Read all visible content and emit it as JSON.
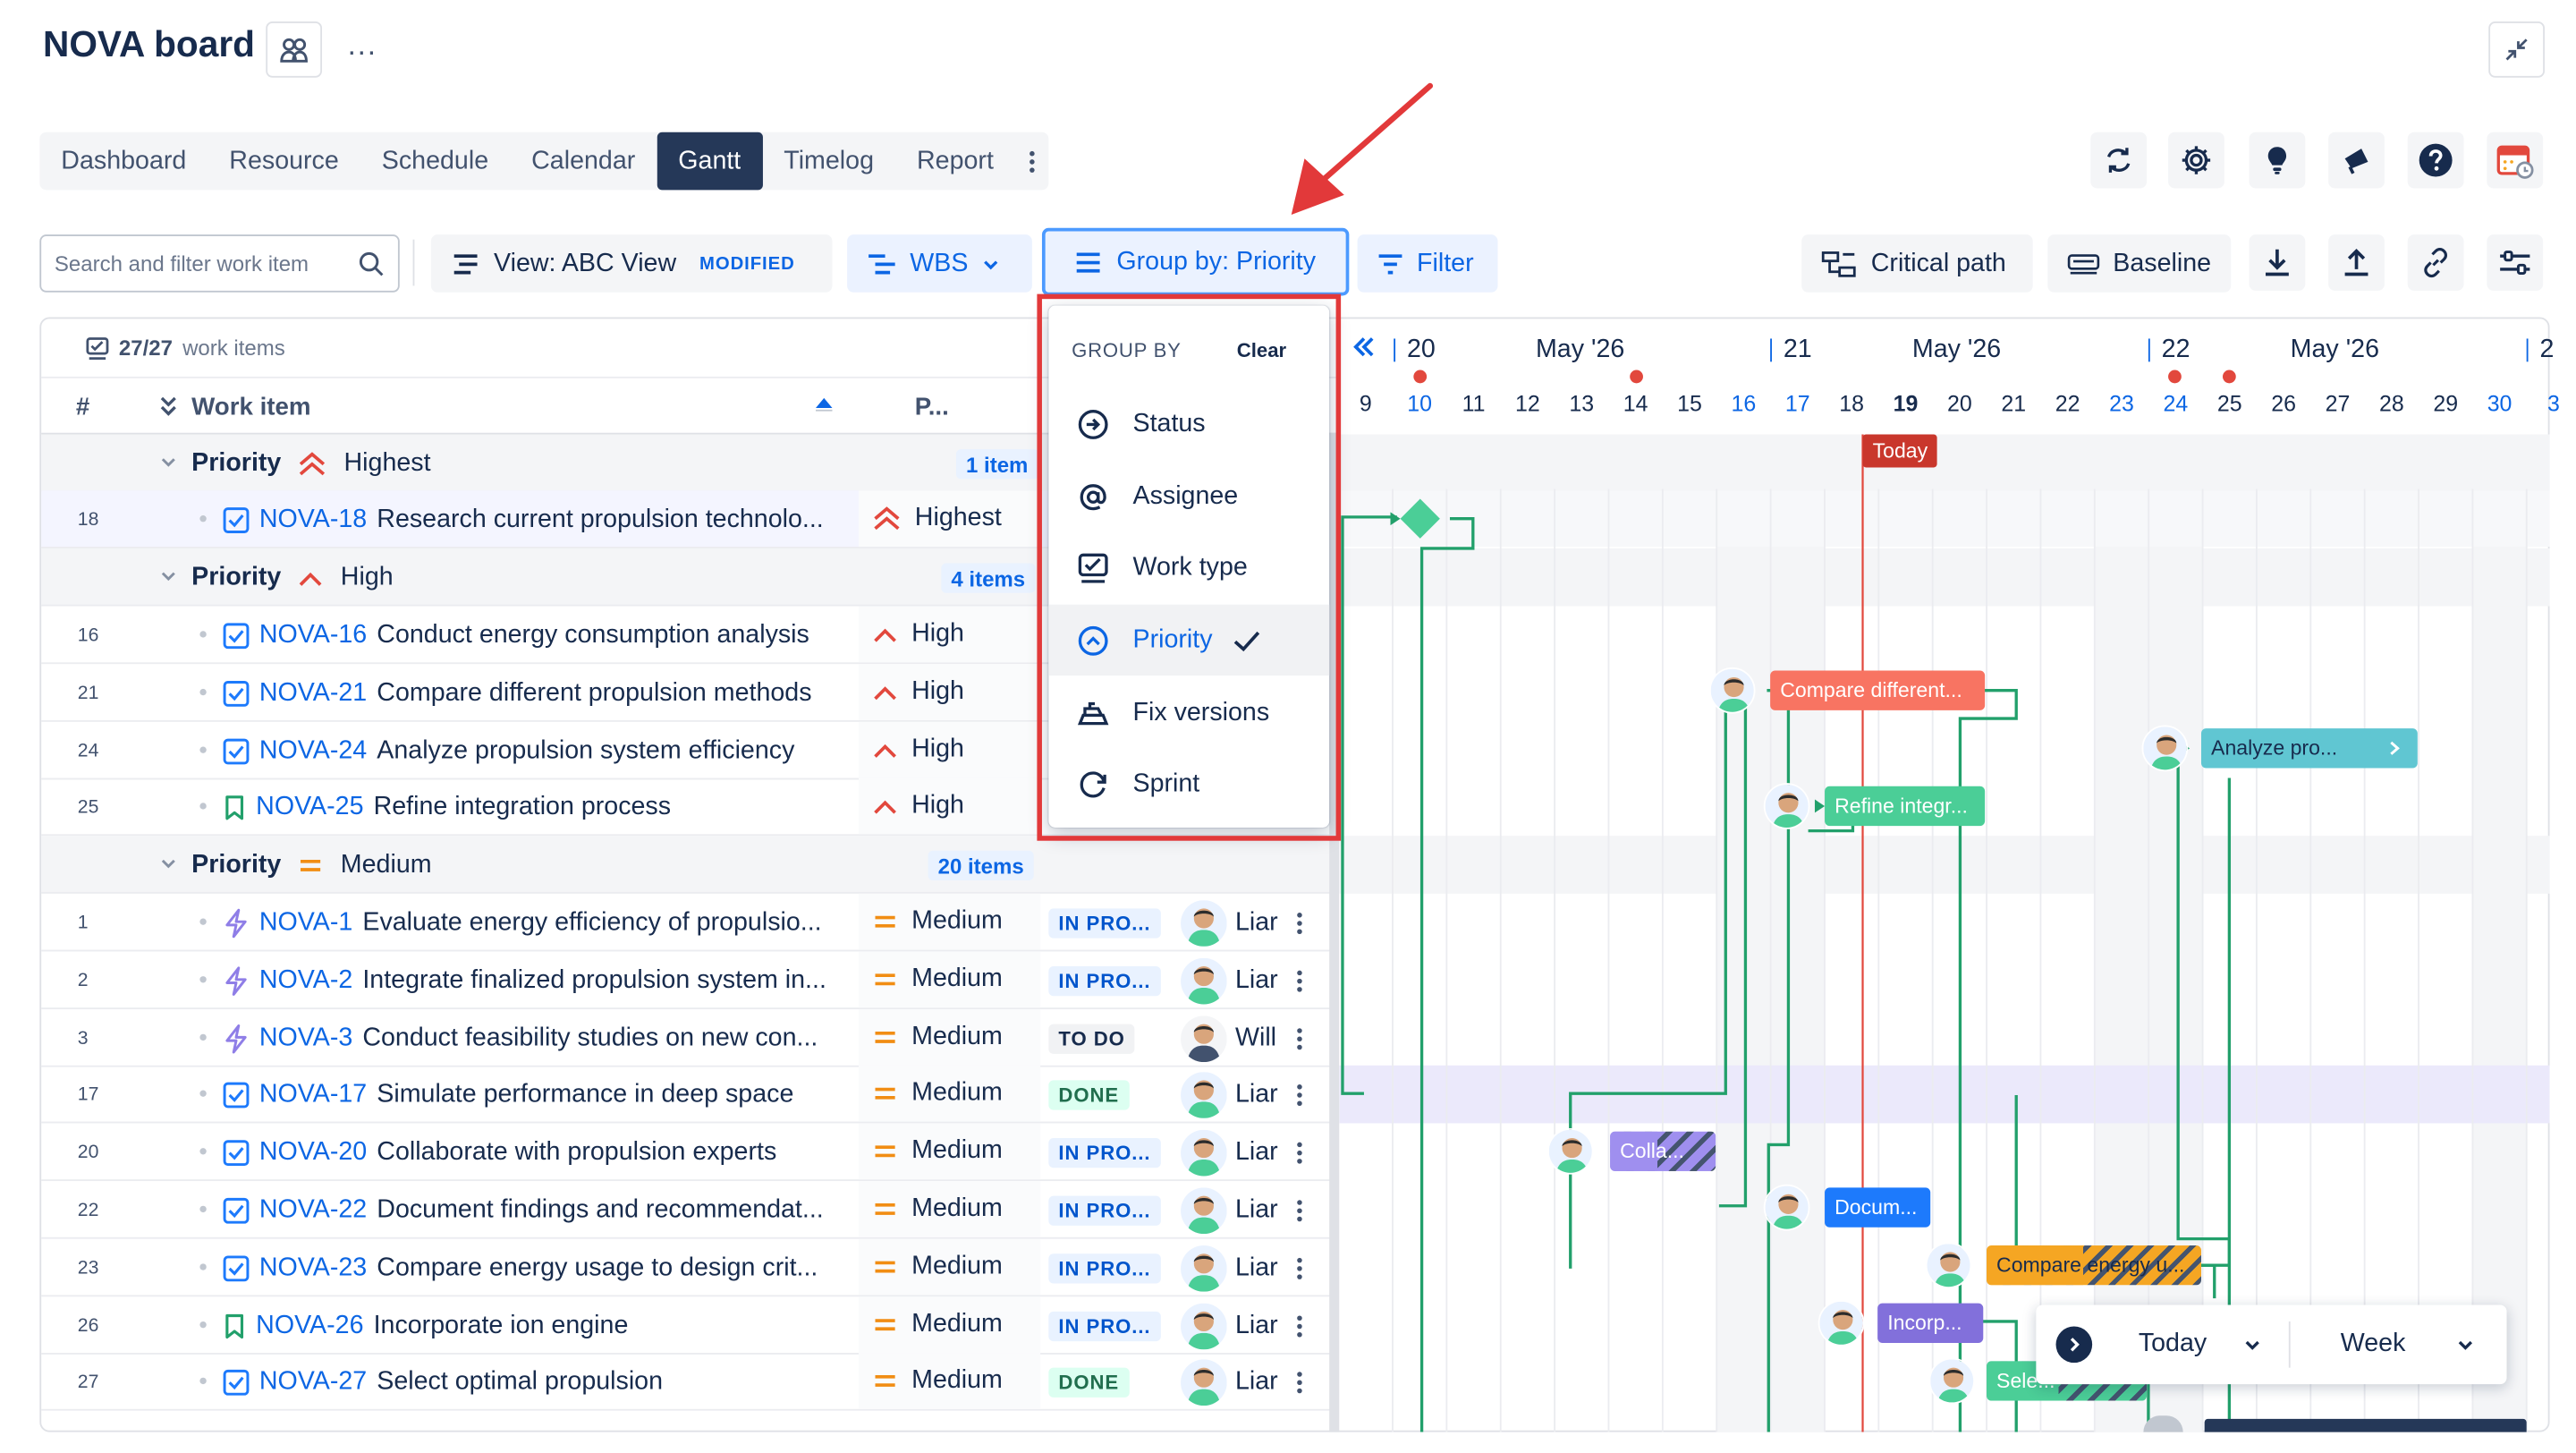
{
  "header": {
    "title": "NOVA board",
    "more_label": "···"
  },
  "tabs": [
    {
      "label": "Dashboard"
    },
    {
      "label": "Resource"
    },
    {
      "label": "Schedule"
    },
    {
      "label": "Calendar"
    },
    {
      "label": "Gantt",
      "active": true
    },
    {
      "label": "Timelog"
    },
    {
      "label": "Report"
    }
  ],
  "toolbar": {
    "search_placeholder": "Search and filter work item",
    "view_label": "View: ABC View",
    "view_badge": "MODIFIED",
    "wbs_label": "WBS",
    "group_label": "Group by: Priority",
    "filter_label": "Filter",
    "critical_path_label": "Critical path",
    "baseline_label": "Baseline"
  },
  "grid": {
    "count": "27/27",
    "count_suffix": "work items",
    "col_num": "#",
    "col_work_item": "Work item",
    "col_priority": "P..."
  },
  "groups": [
    {
      "label": "Priority",
      "value": "Highest",
      "count": "1 item"
    },
    {
      "label": "Priority",
      "value": "High",
      "count": "4 items"
    },
    {
      "label": "Priority",
      "value": "Medium",
      "count": "20 items"
    }
  ],
  "rows": [
    {
      "num": "18",
      "key": "NOVA-18",
      "title": "Research current propulsion technolo...",
      "priority": "Highest",
      "type": "task"
    },
    {
      "num": "16",
      "key": "NOVA-16",
      "title": "Conduct energy consumption analysis",
      "priority": "High",
      "type": "task"
    },
    {
      "num": "21",
      "key": "NOVA-21",
      "title": "Compare different propulsion methods",
      "priority": "High",
      "type": "task"
    },
    {
      "num": "24",
      "key": "NOVA-24",
      "title": "Analyze propulsion system efficiency",
      "priority": "High",
      "type": "task"
    },
    {
      "num": "25",
      "key": "NOVA-25",
      "title": "Refine integration process",
      "priority": "High",
      "type": "story"
    },
    {
      "num": "1",
      "key": "NOVA-1",
      "title": "Evaluate energy efficiency of propulsio...",
      "priority": "Medium",
      "type": "epic",
      "status": "IN PRO...",
      "assignee": "Liar"
    },
    {
      "num": "2",
      "key": "NOVA-2",
      "title": "Integrate finalized propulsion system in...",
      "priority": "Medium",
      "type": "epic",
      "status": "IN PRO...",
      "assignee": "Liar"
    },
    {
      "num": "3",
      "key": "NOVA-3",
      "title": "Conduct feasibility studies on new con...",
      "priority": "Medium",
      "type": "epic",
      "status": "TO DO",
      "assignee": "Will"
    },
    {
      "num": "17",
      "key": "NOVA-17",
      "title": "Simulate performance in deep space",
      "priority": "Medium",
      "type": "task",
      "status": "DONE",
      "assignee": "Liar"
    },
    {
      "num": "20",
      "key": "NOVA-20",
      "title": "Collaborate with propulsion experts",
      "priority": "Medium",
      "type": "task",
      "status": "IN PRO...",
      "assignee": "Liar"
    },
    {
      "num": "22",
      "key": "NOVA-22",
      "title": "Document findings and recommendat...",
      "priority": "Medium",
      "type": "task",
      "status": "IN PRO...",
      "assignee": "Liar"
    },
    {
      "num": "23",
      "key": "NOVA-23",
      "title": "Compare energy usage to design crit...",
      "priority": "Medium",
      "type": "task",
      "status": "IN PRO...",
      "assignee": "Liar"
    },
    {
      "num": "26",
      "key": "NOVA-26",
      "title": "Incorporate ion engine",
      "priority": "Medium",
      "type": "story",
      "status": "IN PRO...",
      "assignee": "Liar"
    },
    {
      "num": "27",
      "key": "NOVA-27",
      "title": "Select optimal propulsion",
      "priority": "Medium",
      "type": "task",
      "status": "DONE",
      "assignee": "Liar"
    }
  ],
  "dropdown": {
    "heading": "GROUP BY",
    "clear": "Clear",
    "items": [
      {
        "label": "Status"
      },
      {
        "label": "Assignee"
      },
      {
        "label": "Work type"
      },
      {
        "label": "Priority",
        "selected": true
      },
      {
        "label": "Fix versions"
      },
      {
        "label": "Sprint"
      }
    ]
  },
  "timeline": {
    "weeks": [
      {
        "num": "20",
        "month": "May '26"
      },
      {
        "num": "21",
        "month": "May '26"
      },
      {
        "num": "22",
        "month": "May '26"
      },
      {
        "num": "2",
        "month": ""
      }
    ],
    "days": [
      "9",
      "10",
      "11",
      "12",
      "13",
      "14",
      "15",
      "16",
      "17",
      "18",
      "19",
      "20",
      "21",
      "22",
      "23",
      "24",
      "25",
      "26",
      "27",
      "28",
      "29",
      "30",
      "3"
    ],
    "today_day": "19",
    "today_label": "Today",
    "bars": [
      {
        "label": "Compare different...",
        "color": "#f18d13",
        "start_day": "21"
      },
      {
        "label": "Analyze pro...",
        "color": "#60c6d2",
        "start_day": "25"
      },
      {
        "label": "Refine integr...",
        "color": "#4bce97",
        "start_day": "20"
      },
      {
        "label": "Colla...",
        "color": "#9f8fef",
        "start_day": "13"
      },
      {
        "label": "Docum...",
        "color": "#1d7afc",
        "start_day": "19"
      },
      {
        "label": "Compare energy u...",
        "color": "#f5cd47",
        "start_day": "21"
      },
      {
        "label": "Incorp...",
        "color": "#8f7ee7",
        "start_day": "19"
      },
      {
        "label": "Sele...",
        "color": "#4bce97",
        "start_day": "21"
      }
    ]
  },
  "time_widget": {
    "today": "Today",
    "scale": "Week"
  }
}
